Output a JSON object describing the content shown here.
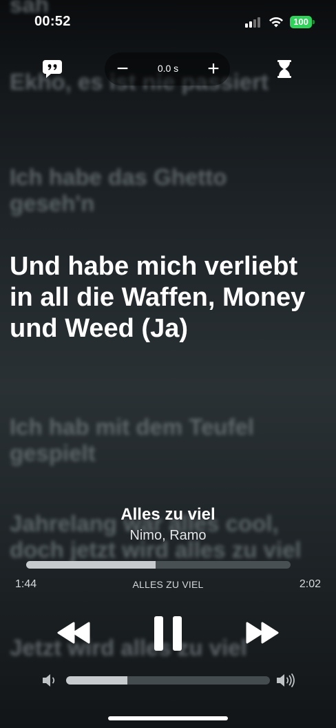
{
  "status_bar": {
    "time": "00:52",
    "battery": "100",
    "signal_bars": 2,
    "battery_color": "#2fd35a"
  },
  "lyrics": [
    {
      "text": "sah",
      "state": "past"
    },
    {
      "text": "Ekho, es ist nie passiert",
      "state": "past"
    },
    {
      "text": "Ich habe das Ghetto geseh'n",
      "state": "past"
    },
    {
      "text": "Und habe mich verliebt in all die Waffen, Money und Weed (Ja)",
      "state": "current"
    },
    {
      "text": "Ich hab mit dem Teufel gespielt",
      "state": "upcoming"
    },
    {
      "text": "Jahrelang war alles cool, doch jetzt wird alles zu viel",
      "state": "upcoming"
    },
    {
      "text": "Jetzt wird alles zu viel",
      "state": "upcoming"
    }
  ],
  "controls": {
    "quote_icon": "quote-bubble-icon",
    "offset_minus": "−",
    "offset_value": "0.0 s",
    "offset_plus": "+",
    "timer_icon": "hourglass-icon"
  },
  "now_playing": {
    "title": "Alles zu viel",
    "artist": "Nimo, Ramo",
    "caption": "ALLES ZU VIEL",
    "elapsed": "1:44",
    "total": "2:02",
    "progress_fraction": 0.49,
    "volume_fraction": 0.3
  },
  "playback": {
    "rewind_icon": "rewind-icon",
    "pause_icon": "pause-icon",
    "forward_icon": "fast-forward-icon",
    "volume_low_icon": "speaker-low-icon",
    "volume_high_icon": "speaker-high-icon"
  }
}
